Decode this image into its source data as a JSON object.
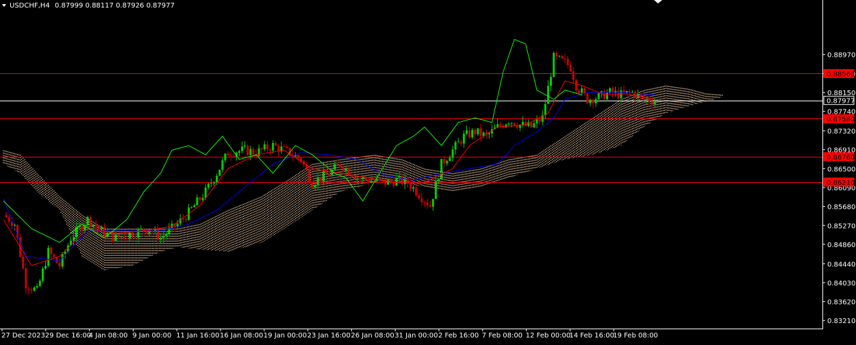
{
  "header": {
    "symbol": "USDCHF,H4",
    "ohlc": "0.87999 0.88117 0.87926 0.87977"
  },
  "colors": {
    "background": "#000000",
    "axis": "#ffffff",
    "bull": "#00d000",
    "bear": "#d00000",
    "tenkan": "#ff0000",
    "kijun": "#0000ff",
    "chikou": "#00ff00",
    "cloud": "#ffd8b0",
    "hline": "#ff0000",
    "price_line": "#ffffff",
    "tag_bg_red": "#ff0000",
    "tag_text_red": "#000000"
  },
  "chart_data": {
    "type": "candlestick",
    "symbol": "USDCHF",
    "timeframe": "H4",
    "ylim": [
      0.8308,
      0.8993
    ],
    "y_ticks": [
      "0.88970",
      "0.88560",
      "0.88150",
      "0.87740",
      "0.87320",
      "0.86910",
      "0.86500",
      "0.86090",
      "0.85680",
      "0.85270",
      "0.84860",
      "0.84440",
      "0.84030",
      "0.83620",
      "0.83210"
    ],
    "x_ticks": [
      "27 Dec 2023",
      "29 Dec 16:00",
      "4 Jan 08:00",
      "9 Jan 00:00",
      "11 Jan 16:00",
      "16 Jan 08:00",
      "19 Jan 00:00",
      "23 Jan 16:00",
      "26 Jan 08:00",
      "31 Jan 00:00",
      "2 Feb 16:00",
      "7 Feb 08:00",
      "12 Feb 00:00",
      "14 Feb 16:00",
      "19 Feb 08:00"
    ],
    "horizontal_lines": [
      {
        "price": 0.8856,
        "label": "0.88560"
      },
      {
        "price": 0.8758,
        "label": "0.87580"
      },
      {
        "price": 0.8676,
        "label": "0.86760"
      },
      {
        "price": 0.8621,
        "label": "0.86210"
      }
    ],
    "current_price": {
      "price": 0.87977,
      "label": "0.87977"
    },
    "close_path": [
      [
        0,
        0.855
      ],
      [
        4,
        0.853
      ],
      [
        8,
        0.84
      ],
      [
        12,
        0.8385
      ],
      [
        16,
        0.847
      ],
      [
        20,
        0.844
      ],
      [
        24,
        0.85
      ],
      [
        30,
        0.854
      ],
      [
        36,
        0.851
      ],
      [
        40,
        0.85
      ],
      [
        46,
        0.851
      ],
      [
        52,
        0.852
      ],
      [
        56,
        0.85
      ],
      [
        62,
        0.853
      ],
      [
        66,
        0.8555
      ],
      [
        72,
        0.86
      ],
      [
        76,
        0.864
      ],
      [
        80,
        0.8685
      ],
      [
        86,
        0.869
      ],
      [
        90,
        0.8685
      ],
      [
        96,
        0.87
      ],
      [
        100,
        0.869
      ],
      [
        106,
        0.867
      ],
      [
        110,
        0.862
      ],
      [
        116,
        0.864
      ],
      [
        120,
        0.866
      ],
      [
        126,
        0.863
      ],
      [
        130,
        0.8625
      ],
      [
        136,
        0.862
      ],
      [
        140,
        0.8625
      ],
      [
        144,
        0.862
      ],
      [
        148,
        0.8595
      ],
      [
        152,
        0.857
      ],
      [
        156,
        0.866
      ],
      [
        160,
        0.869
      ],
      [
        164,
        0.872
      ],
      [
        168,
        0.873
      ],
      [
        172,
        0.872
      ],
      [
        176,
        0.874
      ],
      [
        180,
        0.8755
      ],
      [
        184,
        0.8745
      ],
      [
        188,
        0.874
      ],
      [
        192,
        0.876
      ],
      [
        196,
        0.889
      ],
      [
        200,
        0.888
      ],
      [
        202,
        0.887
      ],
      [
        204,
        0.883
      ],
      [
        208,
        0.88
      ],
      [
        212,
        0.8805
      ],
      [
        216,
        0.8815
      ],
      [
        220,
        0.881
      ],
      [
        224,
        0.8815
      ],
      [
        228,
        0.88
      ],
      [
        232,
        0.8797
      ]
    ],
    "tenkan_path": [
      [
        0,
        0.854
      ],
      [
        10,
        0.844
      ],
      [
        20,
        0.846
      ],
      [
        30,
        0.852
      ],
      [
        40,
        0.851
      ],
      [
        50,
        0.8515
      ],
      [
        60,
        0.8525
      ],
      [
        70,
        0.857
      ],
      [
        80,
        0.865
      ],
      [
        90,
        0.868
      ],
      [
        100,
        0.869
      ],
      [
        110,
        0.865
      ],
      [
        120,
        0.864
      ],
      [
        130,
        0.863
      ],
      [
        140,
        0.862
      ],
      [
        150,
        0.862
      ],
      [
        160,
        0.865
      ],
      [
        166,
        0.87
      ],
      [
        176,
        0.874
      ],
      [
        186,
        0.8745
      ],
      [
        194,
        0.877
      ],
      [
        200,
        0.884
      ],
      [
        206,
        0.883
      ],
      [
        214,
        0.881
      ],
      [
        222,
        0.8812
      ],
      [
        232,
        0.88
      ]
    ],
    "kijun_path": [
      [
        0,
        0.8585
      ],
      [
        8,
        0.846
      ],
      [
        20,
        0.845
      ],
      [
        30,
        0.8515
      ],
      [
        44,
        0.8515
      ],
      [
        56,
        0.8515
      ],
      [
        66,
        0.853
      ],
      [
        76,
        0.856
      ],
      [
        88,
        0.862
      ],
      [
        96,
        0.866
      ],
      [
        106,
        0.8685
      ],
      [
        116,
        0.868
      ],
      [
        126,
        0.867
      ],
      [
        136,
        0.8635
      ],
      [
        146,
        0.8625
      ],
      [
        156,
        0.864
      ],
      [
        166,
        0.865
      ],
      [
        176,
        0.866
      ],
      [
        182,
        0.87
      ],
      [
        190,
        0.873
      ],
      [
        196,
        0.876
      ],
      [
        200,
        0.88
      ],
      [
        208,
        0.8815
      ],
      [
        220,
        0.8815
      ],
      [
        232,
        0.881
      ]
    ],
    "chikou_path": [
      [
        0,
        0.858
      ],
      [
        10,
        0.852
      ],
      [
        20,
        0.849
      ],
      [
        28,
        0.853
      ],
      [
        36,
        0.85
      ],
      [
        44,
        0.854
      ],
      [
        50,
        0.86
      ],
      [
        56,
        0.864
      ],
      [
        60,
        0.869
      ],
      [
        66,
        0.87
      ],
      [
        72,
        0.868
      ],
      [
        78,
        0.872
      ],
      [
        84,
        0.867
      ],
      [
        90,
        0.868
      ],
      [
        96,
        0.864
      ],
      [
        104,
        0.87
      ],
      [
        110,
        0.868
      ],
      [
        118,
        0.864
      ],
      [
        122,
        0.863
      ],
      [
        128,
        0.858
      ],
      [
        134,
        0.864
      ],
      [
        140,
        0.87
      ],
      [
        146,
        0.872
      ],
      [
        150,
        0.874
      ],
      [
        156,
        0.87
      ],
      [
        162,
        0.875
      ],
      [
        168,
        0.876
      ],
      [
        174,
        0.875
      ],
      [
        178,
        0.886
      ],
      [
        182,
        0.893
      ],
      [
        186,
        0.892
      ],
      [
        190,
        0.882
      ],
      [
        196,
        0.88
      ],
      [
        200,
        0.882
      ],
      [
        206,
        0.881
      ]
    ],
    "cloud_top": [
      [
        0,
        0.869
      ],
      [
        6,
        0.868
      ],
      [
        12,
        0.864
      ],
      [
        20,
        0.859
      ],
      [
        28,
        0.855
      ],
      [
        36,
        0.852
      ],
      [
        46,
        0.852
      ],
      [
        56,
        0.852
      ],
      [
        62,
        0.852
      ],
      [
        70,
        0.853
      ],
      [
        80,
        0.856
      ],
      [
        92,
        0.859
      ],
      [
        100,
        0.862
      ],
      [
        110,
        0.866
      ],
      [
        120,
        0.867
      ],
      [
        132,
        0.868
      ],
      [
        142,
        0.867
      ],
      [
        150,
        0.865
      ],
      [
        160,
        0.864
      ],
      [
        170,
        0.865
      ],
      [
        180,
        0.867
      ],
      [
        190,
        0.868
      ],
      [
        200,
        0.872
      ],
      [
        210,
        0.876
      ],
      [
        220,
        0.88
      ],
      [
        228,
        0.882
      ],
      [
        236,
        0.883
      ],
      [
        244,
        0.8823
      ],
      [
        250,
        0.8813
      ],
      [
        256,
        0.881
      ]
    ],
    "cloud_bottom": [
      [
        0,
        0.866
      ],
      [
        6,
        0.864
      ],
      [
        12,
        0.86
      ],
      [
        20,
        0.856
      ],
      [
        28,
        0.846
      ],
      [
        36,
        0.843
      ],
      [
        46,
        0.844
      ],
      [
        56,
        0.847
      ],
      [
        62,
        0.848
      ],
      [
        70,
        0.8475
      ],
      [
        80,
        0.847
      ],
      [
        92,
        0.849
      ],
      [
        100,
        0.852
      ],
      [
        110,
        0.856
      ],
      [
        120,
        0.86
      ],
      [
        132,
        0.862
      ],
      [
        142,
        0.862
      ],
      [
        150,
        0.861
      ],
      [
        160,
        0.86
      ],
      [
        170,
        0.861
      ],
      [
        180,
        0.863
      ],
      [
        190,
        0.865
      ],
      [
        200,
        0.867
      ],
      [
        210,
        0.868
      ],
      [
        220,
        0.87
      ],
      [
        228,
        0.874
      ],
      [
        236,
        0.877
      ],
      [
        244,
        0.8785
      ],
      [
        250,
        0.8795
      ],
      [
        256,
        0.8805
      ]
    ]
  }
}
